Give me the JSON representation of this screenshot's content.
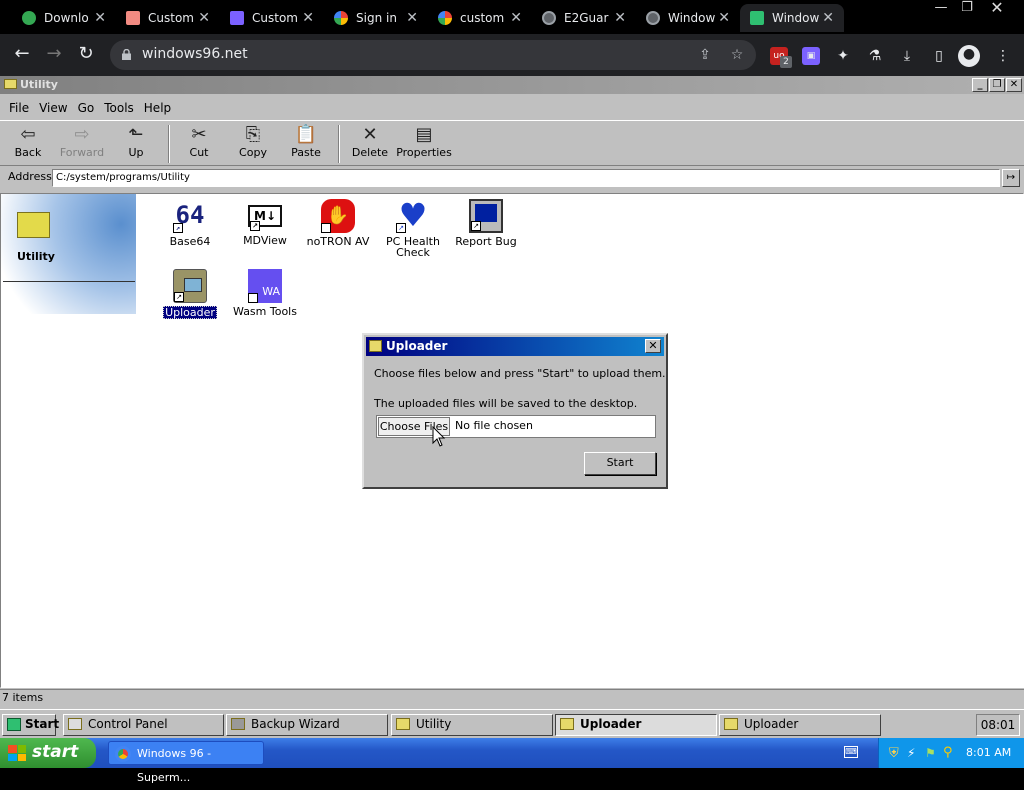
{
  "browser": {
    "tabs": [
      {
        "title": "Downlo",
        "favicon_color": "#34a853",
        "active": false
      },
      {
        "title": "Custom",
        "favicon_color": "#f28b82",
        "active": false
      },
      {
        "title": "Custom",
        "favicon_color": "#7b61ff",
        "active": false
      },
      {
        "title": "Sign in",
        "favicon_color": "#ffffff",
        "active": false
      },
      {
        "title": "custom",
        "favicon_color": "#ffffff",
        "active": false
      },
      {
        "title": "E2Guar",
        "favicon_color": "#9aa0a6",
        "active": false
      },
      {
        "title": "Window",
        "favicon_color": "#9aa0a6",
        "active": false
      },
      {
        "title": "Window",
        "favicon_color": "#2fbf71",
        "active": true
      }
    ],
    "url": "windows96.net",
    "extension_badge": "2"
  },
  "explorer": {
    "window_title": "Utility",
    "menu": [
      "File",
      "View",
      "Go",
      "Tools",
      "Help"
    ],
    "toolbar": {
      "back": "Back",
      "forward": "Forward",
      "up": "Up",
      "cut": "Cut",
      "copy": "Copy",
      "paste": "Paste",
      "delete": "Delete",
      "properties": "Properties"
    },
    "address_label": "Address",
    "address_value": "C:/system/programs/Utility",
    "sidebar_title": "Utility",
    "icons": [
      {
        "label": "Base64",
        "glyph": "64"
      },
      {
        "label": "MDView",
        "glyph": "M↓"
      },
      {
        "label": "noTRON AV",
        "glyph": "✋"
      },
      {
        "label": "PC Health Check",
        "glyph": "♥"
      },
      {
        "label": "Report Bug",
        "glyph": "🐞"
      },
      {
        "label": "Uploader",
        "glyph": "▤",
        "selected": true
      },
      {
        "label": "Wasm Tools",
        "glyph": "WA"
      }
    ],
    "status": "7 items"
  },
  "dialog": {
    "title": "Uploader",
    "line1": "Choose files below and press \"Start\" to upload them.",
    "line2": "The uploaded files will be saved to the desktop.",
    "choose_files": "Choose Files",
    "no_file": "No file chosen",
    "start": "Start"
  },
  "w96_taskbar": {
    "start": "Start",
    "tasks": [
      {
        "label": "Control Panel",
        "active": false
      },
      {
        "label": "Backup Wizard",
        "active": false
      },
      {
        "label": "Utility",
        "active": false
      },
      {
        "label": "Uploader",
        "active": true
      },
      {
        "label": "Uploader",
        "active": false
      }
    ],
    "clock": "08:01"
  },
  "xp_taskbar": {
    "start": "start",
    "task": "Windows 96 - Superm...",
    "clock": "8:01 AM"
  }
}
